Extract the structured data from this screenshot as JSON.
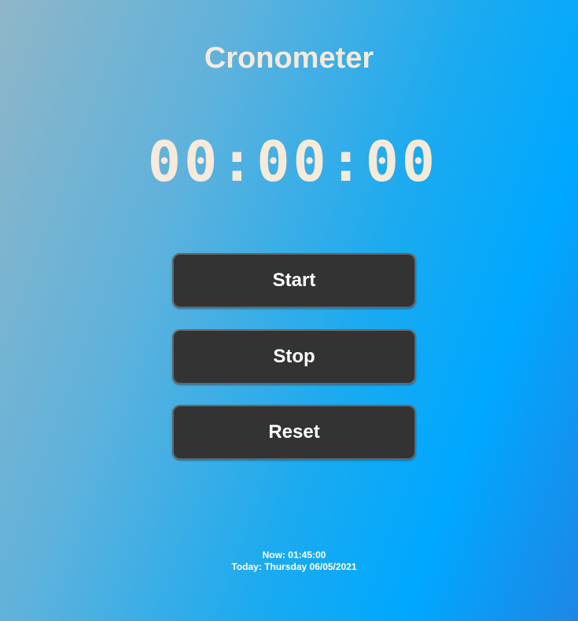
{
  "app": {
    "title": "Cronometer"
  },
  "timer": {
    "display": "00:00:00"
  },
  "controls": {
    "start_label": "Start",
    "stop_label": "Stop",
    "reset_label": "Reset"
  },
  "info": {
    "now_text": "Now: 01:45:00",
    "today_text": "Today: Thursday 06/05/2021"
  },
  "colors": {
    "text_cream": "#f6eadb",
    "button_bg": "#333333",
    "button_border": "#666666"
  }
}
